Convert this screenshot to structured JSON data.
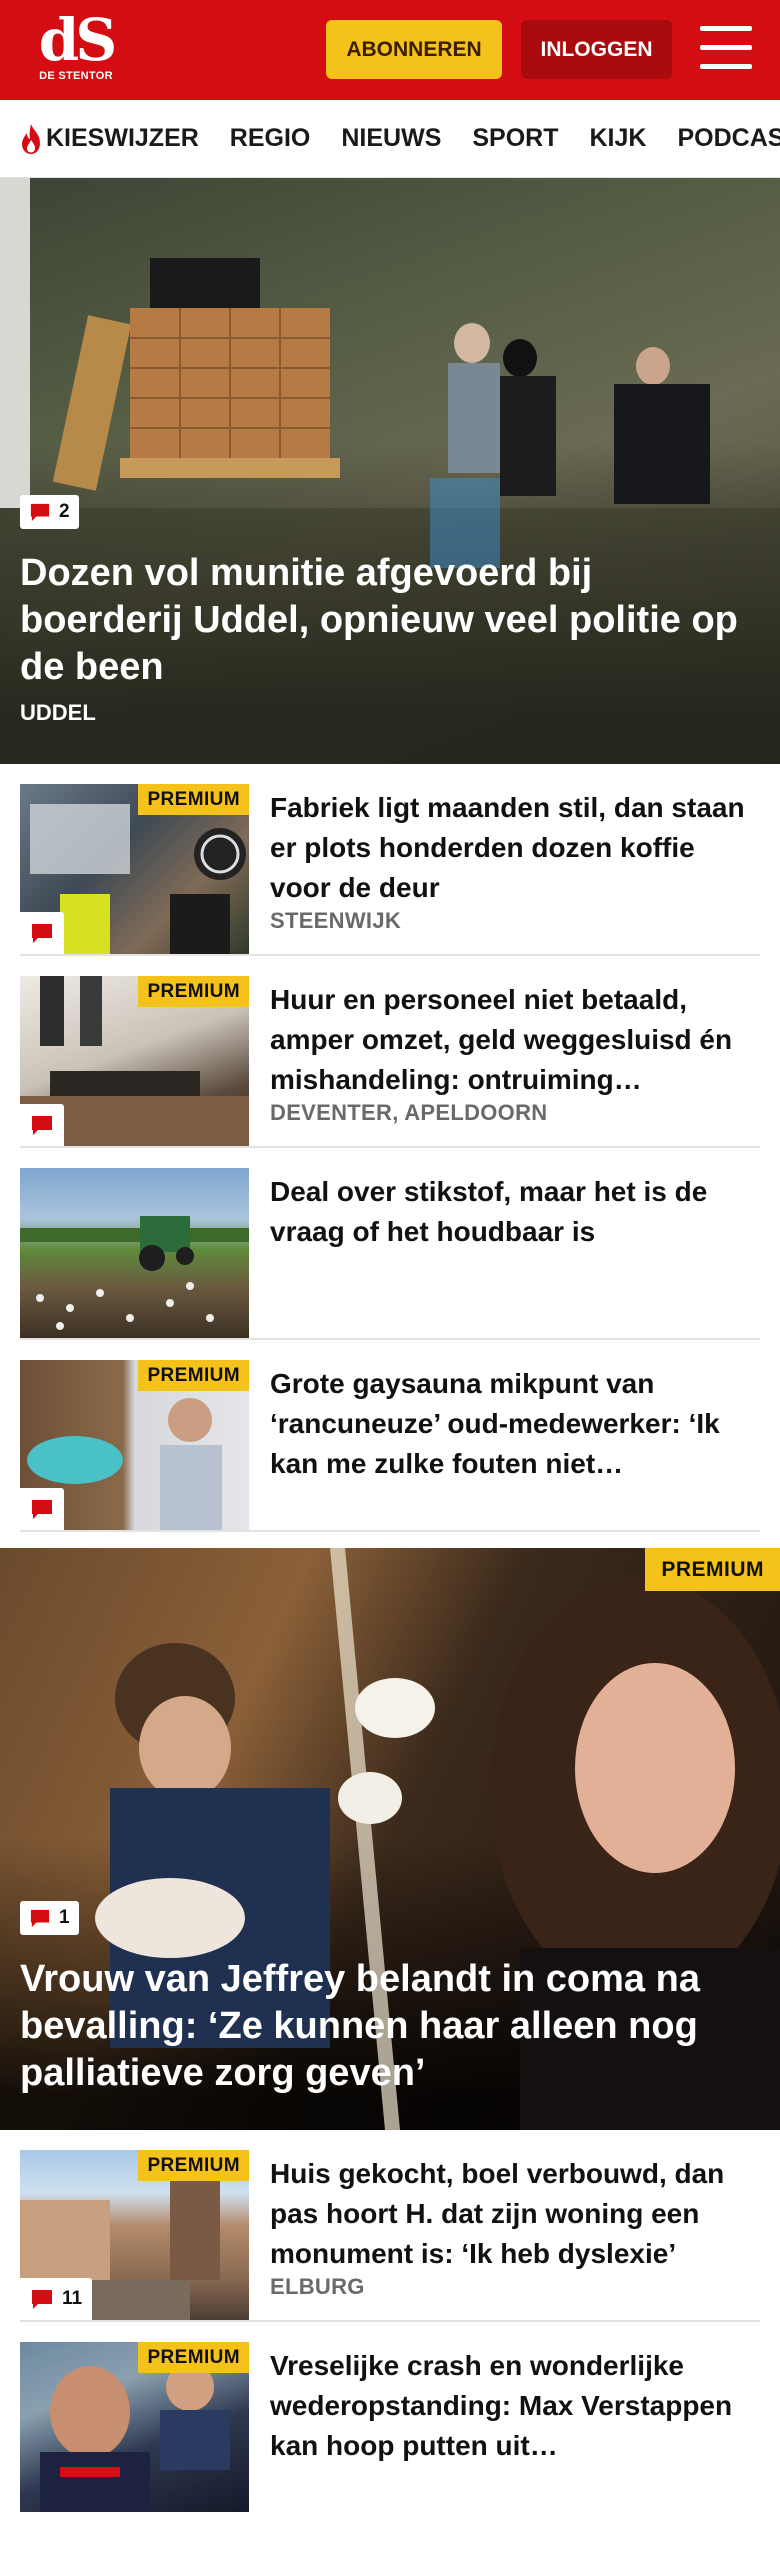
{
  "header": {
    "logo_mark": "dS",
    "logo_name": "DE STENTOR",
    "subscribe_label": "ABONNEREN",
    "login_label": "INLOGGEN"
  },
  "nav": {
    "items": [
      "KIESWIJZER",
      "REGIO",
      "NIEUWS",
      "SPORT",
      "KIJK",
      "PODCAST"
    ]
  },
  "hero1": {
    "comments": "2",
    "title": "Dozen vol munitie afgevoerd bij boerderij Uddel, opnieuw veel politie op de been",
    "tag": "UDDEL"
  },
  "articles1": [
    {
      "premium": "PREMIUM",
      "comments": "",
      "title": "Fabriek ligt maanden stil, dan staan er plots honderden dozen koffie voor de deur",
      "tag": "STEENWIJK"
    },
    {
      "premium": "PREMIUM",
      "comments": "",
      "title": "Huur en personeel niet betaald, amper omzet, geld weggesluisd én mishandeling: ontruiming…",
      "tag": "DEVENTER, APELDOORN"
    },
    {
      "premium": "",
      "comments": "",
      "title": "Deal over stikstof, maar het is de vraag of het houdbaar is",
      "tag": ""
    },
    {
      "premium": "PREMIUM",
      "comments": "",
      "title": "Grote gaysauna mikpunt van ‘rancuneuze’ oud-medewerker: ‘Ik kan me zulke fouten niet…",
      "tag": ""
    }
  ],
  "hero2": {
    "premium": "PREMIUM",
    "comments": "1",
    "title": "Vrouw van Jeffrey belandt in coma na bevalling: ‘Ze kunnen haar alleen nog palliatieve zorg geven’"
  },
  "articles2": [
    {
      "premium": "PREMIUM",
      "comments": "11",
      "title": "Huis gekocht, boel verbouwd, dan pas hoort H. dat zijn woning een monument is: ‘Ik heb dyslexie’",
      "tag": "ELBURG"
    },
    {
      "premium": "PREMIUM",
      "comments": "",
      "title": "Vreselijke crash en wonderlijke wederopstanding: Max Verstappen kan hoop putten uit…",
      "tag": ""
    }
  ],
  "colors": {
    "brand_red": "#d40d12",
    "login_red": "#a80a0e",
    "premium_yellow": "#f4c21a",
    "comment_red": "#d40d12"
  },
  "icons": [
    "flame-icon",
    "menu-icon",
    "comment-icon"
  ]
}
